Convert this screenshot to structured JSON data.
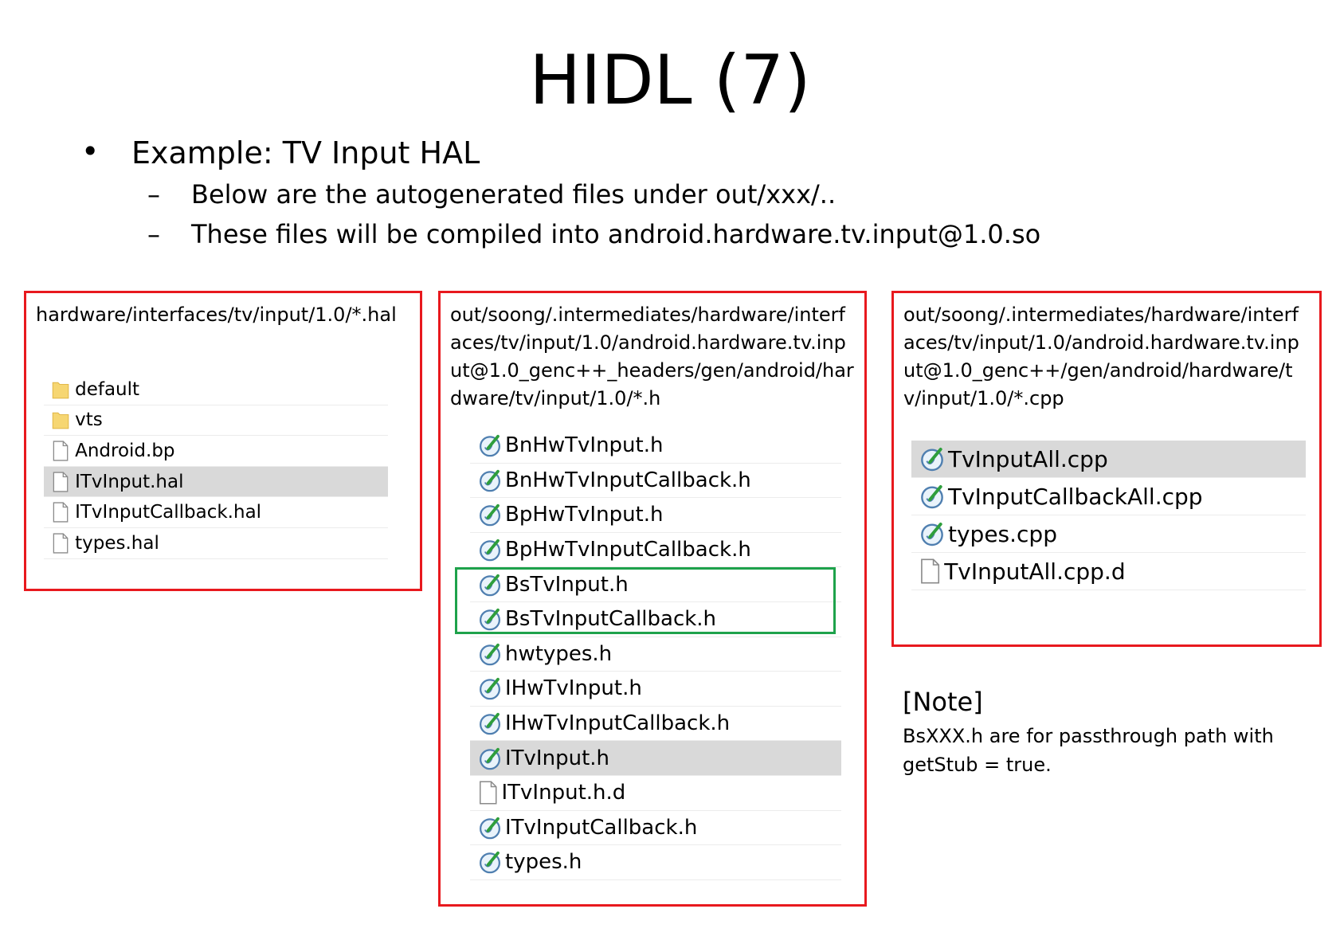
{
  "slide": {
    "title": "HIDL (7)",
    "bullet": {
      "marker": "•",
      "text": "Example: TV Input HAL",
      "subs": [
        {
          "marker": "–",
          "text": "Below are the autogenerated files under out/xxx/.."
        },
        {
          "marker": "–",
          "text": "These files will be compiled into android.hardware.tv.input@1.0.so"
        }
      ]
    }
  },
  "panels": [
    {
      "path": "hardware/interfaces/tv/input/1.0/*.hal",
      "files": [
        {
          "name": "default",
          "icon": "folder-icon",
          "selected": false
        },
        {
          "name": "vts",
          "icon": "folder-icon",
          "selected": false
        },
        {
          "name": "Android.bp",
          "icon": "file-icon",
          "selected": false
        },
        {
          "name": "ITvInput.hal",
          "icon": "file-icon",
          "selected": true
        },
        {
          "name": "ITvInputCallback.hal",
          "icon": "file-icon",
          "selected": false
        },
        {
          "name": "types.hal",
          "icon": "file-icon",
          "selected": false
        }
      ]
    },
    {
      "path": "out/soong/.intermediates/hardware/interfaces/tv/input/1.0/android.hardware.tv.input@1.0_genc++_headers/gen/android/hardware/tv/input/1.0/*.h",
      "files": [
        {
          "name": "BnHwTvInput.h",
          "icon": "source-file-icon",
          "selected": false
        },
        {
          "name": "BnHwTvInputCallback.h",
          "icon": "source-file-icon",
          "selected": false
        },
        {
          "name": "BpHwTvInput.h",
          "icon": "source-file-icon",
          "selected": false
        },
        {
          "name": "BpHwTvInputCallback.h",
          "icon": "source-file-icon",
          "selected": false
        },
        {
          "name": "BsTvInput.h",
          "icon": "source-file-icon",
          "selected": false
        },
        {
          "name": "BsTvInputCallback.h",
          "icon": "source-file-icon",
          "selected": false
        },
        {
          "name": "hwtypes.h",
          "icon": "source-file-icon",
          "selected": false
        },
        {
          "name": "IHwTvInput.h",
          "icon": "source-file-icon",
          "selected": false
        },
        {
          "name": "IHwTvInputCallback.h",
          "icon": "source-file-icon",
          "selected": false
        },
        {
          "name": "ITvInput.h",
          "icon": "source-file-icon",
          "selected": true
        },
        {
          "name": "ITvInput.h.d",
          "icon": "file-icon",
          "selected": false
        },
        {
          "name": "ITvInputCallback.h",
          "icon": "source-file-icon",
          "selected": false
        },
        {
          "name": "types.h",
          "icon": "source-file-icon",
          "selected": false
        }
      ]
    },
    {
      "path": "out/soong/.intermediates/hardware/interfaces/tv/input/1.0/android.hardware.tv.input@1.0_genc++/gen/android/hardware/tv/input/1.0/*.cpp",
      "files": [
        {
          "name": "TvInputAll.cpp",
          "icon": "source-file-icon",
          "selected": true
        },
        {
          "name": "TvInputCallbackAll.cpp",
          "icon": "source-file-icon",
          "selected": false
        },
        {
          "name": "types.cpp",
          "icon": "source-file-icon",
          "selected": false
        },
        {
          "name": "TvInputAll.cpp.d",
          "icon": "file-icon",
          "selected": false
        }
      ]
    }
  ],
  "note": {
    "heading": "[Note]",
    "body": "BsXXX.h are for passthrough path with getStub = true."
  },
  "colors": {
    "panel_border": "#e8191e",
    "highlight_border": "#1ea24b",
    "selected_row": "#d9d9d9",
    "folder": "#f6d672"
  }
}
